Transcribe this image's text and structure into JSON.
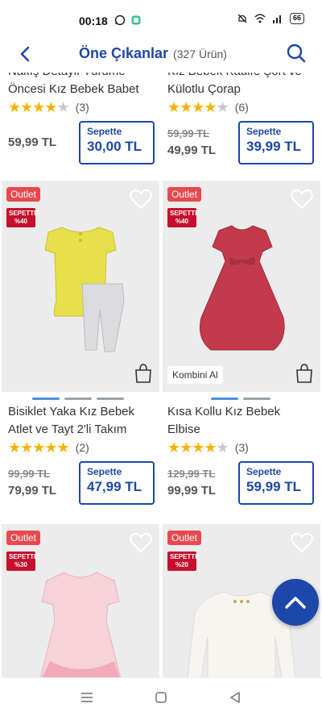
{
  "status": {
    "time": "00:18",
    "battery": "66"
  },
  "header": {
    "title": "Öne Çıkanlar",
    "count": "(327 Ürün)"
  },
  "products": [
    {
      "name": "Nakış Detaylı Yürüme Öncesi Kız Bebek Babet",
      "rating_stars": 4,
      "rating_count": "(3)",
      "old_price": "",
      "price": "59,99 TL",
      "basket_label": "Sepette",
      "basket_price": "30,00 TL"
    },
    {
      "name": "Kız Bebek Kadife Şort ve Külotlu Çorap",
      "rating_stars": 4,
      "rating_count": "(6)",
      "old_price": "59,99 TL",
      "price": "49,99 TL",
      "basket_label": "Sepette",
      "basket_price": "39,99 TL"
    },
    {
      "outlet": "Outlet",
      "sepette_badge_1": "SEPETTE",
      "sepette_badge_2": "%40",
      "name": "Bisiklet Yaka Kız Bebek Atlet ve Tayt 2'li Takım",
      "rating_stars": 5,
      "rating_count": "(2)",
      "old_price": "99,99 TL",
      "price": "79,99 TL",
      "basket_label": "Sepette",
      "basket_price": "47,99 TL"
    },
    {
      "outlet": "Outlet",
      "sepette_badge_1": "SEPETTE",
      "sepette_badge_2": "%40",
      "kombin": "Kombini Al",
      "name": "Kısa Kollu Kız Bebek Elbise",
      "rating_stars": 4,
      "rating_count": "(3)",
      "old_price": "129,99 TL",
      "price": "99,99 TL",
      "basket_label": "Sepette",
      "basket_price": "59,99 TL"
    },
    {
      "outlet": "Outlet",
      "sepette_badge_1": "SEPETTE",
      "sepette_badge_2": "%30"
    },
    {
      "outlet": "Outlet",
      "sepette_badge_1": "SEPETTE",
      "sepette_badge_2": "%20"
    }
  ],
  "colors": {
    "brand_blue": "#1d47a8",
    "outlet_red": "#e8494f",
    "badge_red": "#c7102e",
    "star": "#f5b301"
  },
  "icons": [
    "back-arrow-icon",
    "search-icon",
    "heart-icon",
    "shopping-bag-icon",
    "chevron-up-icon",
    "menu-nav-icon",
    "home-nav-icon",
    "back-nav-icon"
  ]
}
